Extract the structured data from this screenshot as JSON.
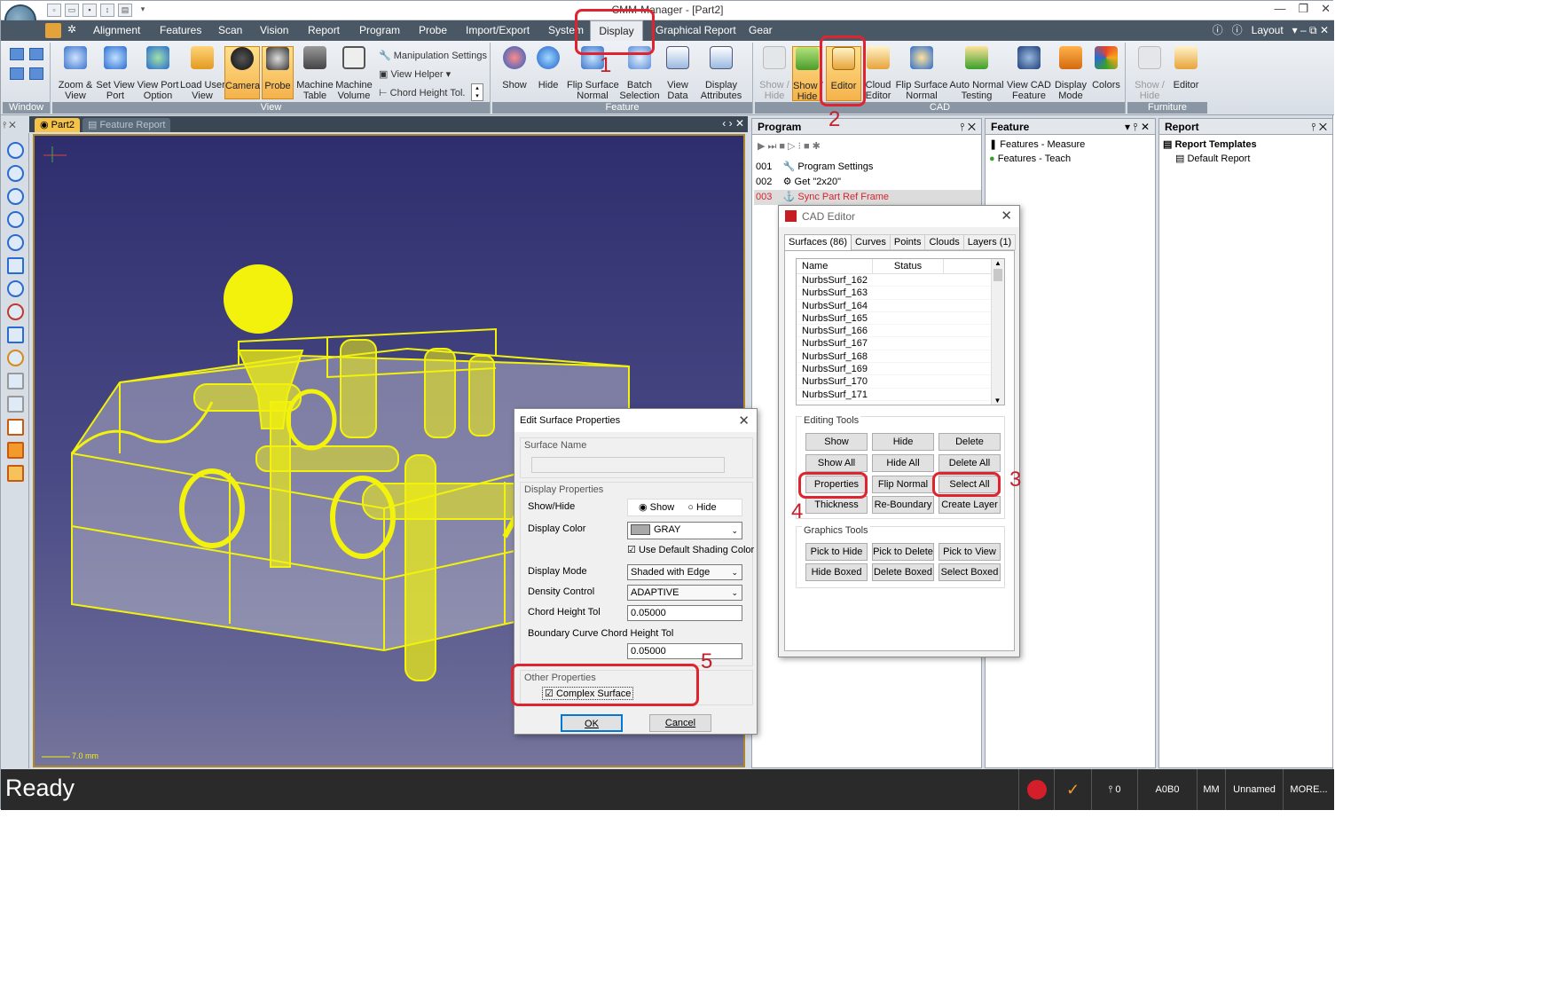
{
  "window": {
    "title": "CMM-Manager - [Part2]",
    "layout_label": "Layout"
  },
  "menu": {
    "items": [
      "Alignment",
      "Features",
      "Scan",
      "Vision",
      "Report",
      "Program",
      "Probe",
      "Import/Export",
      "System",
      "Display",
      "Graphical Report",
      "Gear"
    ]
  },
  "ribbon": {
    "window_group": "Window",
    "view_group": "View",
    "view_buttons": [
      "Zoom &\nView",
      "Set View\nPort",
      "View Port\nOption",
      "Load User\nView",
      "Camera",
      "Probe",
      "Machine\nTable",
      "Machine\nVolume"
    ],
    "view_small": [
      "Manipulation Settings",
      "View Helper",
      "Chord Height Tol."
    ],
    "feature_group": "Feature",
    "feature_buttons": [
      "Show",
      "Hide",
      "Flip Surface\nNormal",
      "Batch\nSelection",
      "View\nData",
      "Display\nAttributes"
    ],
    "cad_group": "CAD",
    "cad_buttons": [
      "Show /\nHide",
      "Show /\nHide",
      "Editor",
      "Cloud\nEditor",
      "Flip Surface\nNormal",
      "Auto Normal\nTesting",
      "View CAD\nFeature",
      "Display\nMode",
      "Colors"
    ],
    "furniture_group": "Furniture",
    "furniture_buttons": [
      "Show /\nHide",
      "Editor"
    ]
  },
  "viewport": {
    "tabs": [
      "Part2",
      "Feature Report"
    ],
    "scale_label": "7.0 mm"
  },
  "program_panel": {
    "title": "Program",
    "rows": [
      {
        "num": "001",
        "label": "Program Settings"
      },
      {
        "num": "002",
        "label": "Get \"2x20\""
      },
      {
        "num": "003",
        "label": "Sync Part Ref Frame"
      }
    ]
  },
  "feature_panel": {
    "title": "Feature",
    "items": [
      "Features - Measure",
      "Features - Teach"
    ]
  },
  "report_panel": {
    "title": "Report",
    "items": [
      "Report Templates",
      "Default Report"
    ]
  },
  "cad_editor": {
    "title": "CAD Editor",
    "tabs": [
      "Surfaces (86)",
      "Curves",
      "Points",
      "Clouds",
      "Layers (1)"
    ],
    "columns": [
      "Name",
      "Status"
    ],
    "surfaces": [
      "NurbsSurf_162",
      "NurbsSurf_163",
      "NurbsSurf_164",
      "NurbsSurf_165",
      "NurbsSurf_166",
      "NurbsSurf_167",
      "NurbsSurf_168",
      "NurbsSurf_169",
      "NurbsSurf_170",
      "NurbsSurf_171"
    ],
    "editing_tools_label": "Editing Tools",
    "editing_tools": [
      "Show",
      "Hide",
      "Delete",
      "Show All",
      "Hide All",
      "Delete All",
      "Properties",
      "Flip Normal",
      "Select All",
      "Thickness",
      "Re-Boundary",
      "Create Layer"
    ],
    "graphics_tools_label": "Graphics Tools",
    "graphics_tools": [
      "Pick to Hide",
      "Pick to Delete",
      "Pick to View",
      "Hide Boxed",
      "Delete Boxed",
      "Select Boxed"
    ]
  },
  "surface_dialog": {
    "title": "Edit Surface Properties",
    "surface_name_label": "Surface Name",
    "surface_name_value": "",
    "display_properties_label": "Display Properties",
    "show_hide_label": "Show/Hide",
    "show_option": "Show",
    "hide_option": "Hide",
    "display_color_label": "Display Color",
    "display_color_value": "GRAY",
    "use_default_shading": "Use Default Shading Color",
    "display_mode_label": "Display Mode",
    "display_mode_value": "Shaded with Edge",
    "density_control_label": "Density Control",
    "density_control_value": "ADAPTIVE",
    "chord_height_label": "Chord Height Tol",
    "chord_height_value": "0.05000",
    "boundary_label": "Boundary Curve Chord Height Tol",
    "boundary_value": "0.05000",
    "other_properties_label": "Other Properties",
    "complex_surface_label": "Complex Surface",
    "ok_label": "OK",
    "cancel_label": "Cancel"
  },
  "status_bar": {
    "ready": "Ready",
    "probe_count": "0",
    "tip": "A0B0",
    "units": "MM",
    "name": "Unnamed",
    "more": "MORE..."
  },
  "annotations": [
    "1",
    "2",
    "3",
    "4",
    "5"
  ],
  "colors": {
    "accent": "#e0242f",
    "model": "#f2f20c",
    "menubar": "#4a5866"
  }
}
